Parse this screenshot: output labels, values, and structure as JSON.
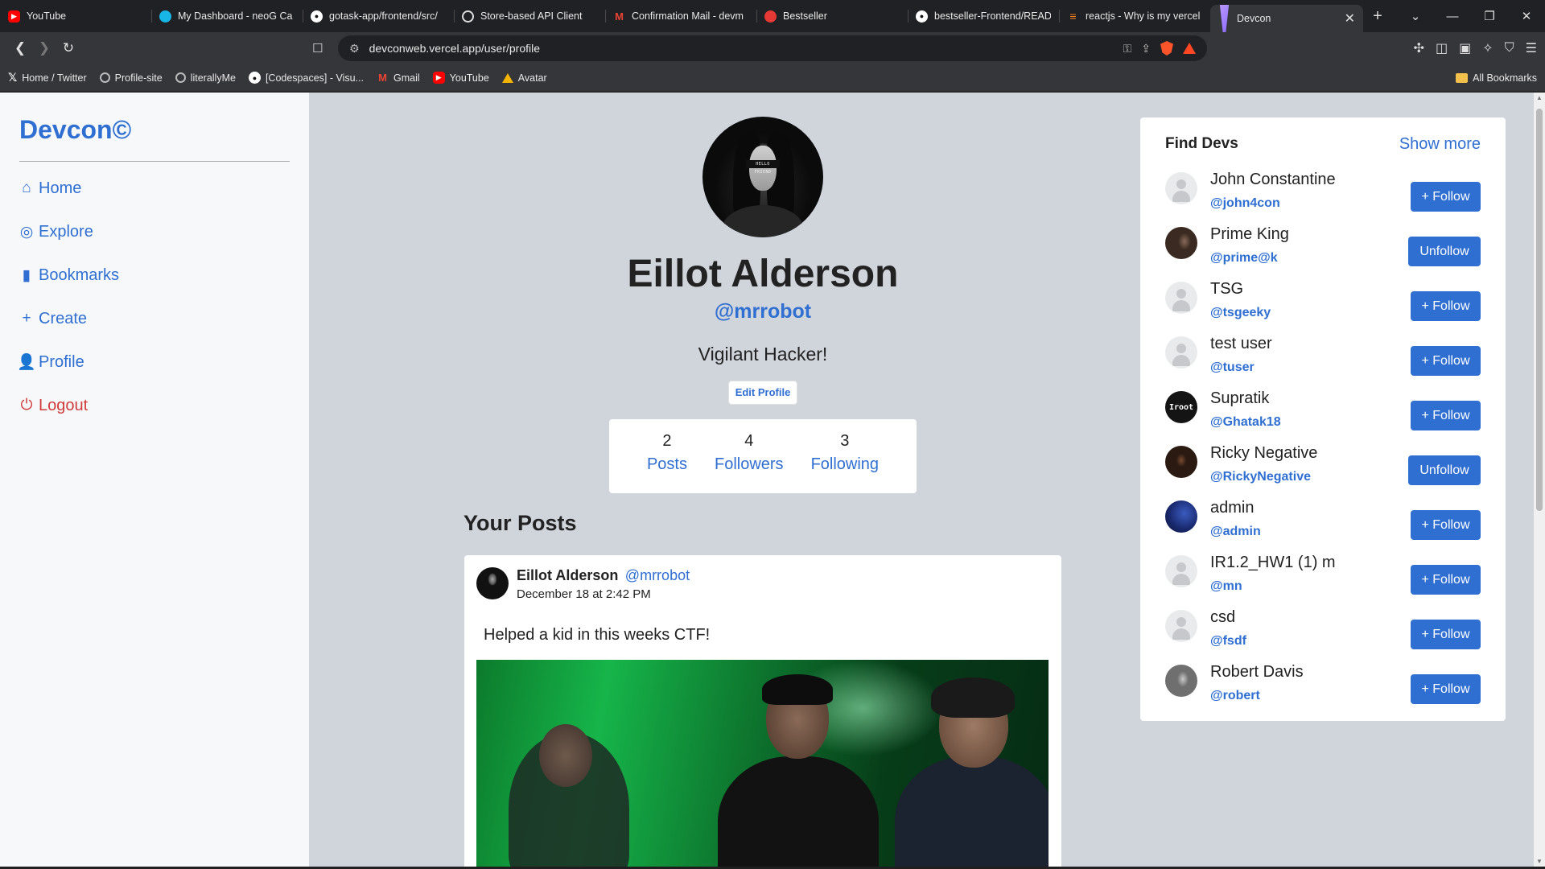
{
  "browser": {
    "tabs": [
      {
        "title": "YouTube",
        "icon": "youtube-icon"
      },
      {
        "title": "My Dashboard - neoG Ca",
        "icon": "neog-icon"
      },
      {
        "title": "gotask-app/frontend/src/",
        "icon": "github-icon"
      },
      {
        "title": "Store-based API Client",
        "icon": "api-client-icon"
      },
      {
        "title": "Confirmation Mail - devm",
        "icon": "gmail-icon"
      },
      {
        "title": "Bestseller",
        "icon": "bestseller-icon"
      },
      {
        "title": "bestseller-Frontend/READ",
        "icon": "github-icon"
      },
      {
        "title": "reactjs - Why is my vercel",
        "icon": "stackoverflow-icon"
      },
      {
        "title": "Devcon",
        "icon": "devcon-icon",
        "active": true
      }
    ],
    "url": "devconweb.vercel.app/user/profile",
    "bookmarks": [
      {
        "label": "Home / Twitter",
        "icon": "x-icon"
      },
      {
        "label": "Profile-site",
        "icon": "globe-icon"
      },
      {
        "label": "literallyMe",
        "icon": "globe-icon"
      },
      {
        "label": "[Codespaces] - Visu...",
        "icon": "github-icon"
      },
      {
        "label": "Gmail",
        "icon": "gmail-icon"
      },
      {
        "label": "YouTube",
        "icon": "youtube-icon"
      },
      {
        "label": "Avatar",
        "icon": "drive-icon"
      }
    ],
    "all_bookmarks": "All Bookmarks"
  },
  "sidebar": {
    "brand": "Devcon©",
    "items": [
      {
        "label": "Home",
        "icon": "home-icon"
      },
      {
        "label": "Explore",
        "icon": "compass-icon"
      },
      {
        "label": "Bookmarks",
        "icon": "bookmark-icon"
      },
      {
        "label": "Create",
        "icon": "plus-icon"
      },
      {
        "label": "Profile",
        "icon": "user-icon"
      },
      {
        "label": "Logout",
        "icon": "power-icon"
      }
    ]
  },
  "profile": {
    "name": "Eillot Alderson",
    "handle": "@mrrobot",
    "bio": "Vigilant Hacker!",
    "edit_label": "Edit Profile",
    "avatar_caption": "HELLO FRIEND",
    "stats": [
      {
        "num": "2",
        "label": "Posts"
      },
      {
        "num": "4",
        "label": "Followers"
      },
      {
        "num": "3",
        "label": "Following"
      }
    ]
  },
  "posts_section": {
    "title": "Your Posts",
    "posts": [
      {
        "author": "Eillot Alderson",
        "handle": "@mrrobot",
        "date": "December 18 at 2:42 PM",
        "content": "Helped a kid in this weeks CTF!"
      }
    ]
  },
  "find_devs": {
    "title": "Find Devs",
    "show_more": "Show more",
    "devs": [
      {
        "name": "John Constantine",
        "handle": "@john4con",
        "action": "+ Follow"
      },
      {
        "name": "Prime King",
        "handle": "@prime@k",
        "action": "Unfollow"
      },
      {
        "name": "TSG",
        "handle": "@tsgeeky",
        "action": "+ Follow"
      },
      {
        "name": "test user",
        "handle": "@tuser",
        "action": "+ Follow"
      },
      {
        "name": "Supratik",
        "handle": "@Ghatak18",
        "action": "+ Follow",
        "avatar_text": "Iroot"
      },
      {
        "name": "Ricky Negative",
        "handle": "@RickyNegative",
        "action": "Unfollow"
      },
      {
        "name": "admin",
        "handle": "@admin",
        "action": "+ Follow"
      },
      {
        "name": "IR1.2_HW1 (1) m",
        "handle": "@mn",
        "action": "+ Follow"
      },
      {
        "name": "csd",
        "handle": "@fsdf",
        "action": "+ Follow"
      },
      {
        "name": "Robert Davis",
        "handle": "@robert",
        "action": "+ Follow"
      }
    ]
  },
  "colors": {
    "accent": "#2f6fd1",
    "danger": "#d03b3b",
    "page_bg": "#d0d4db"
  }
}
